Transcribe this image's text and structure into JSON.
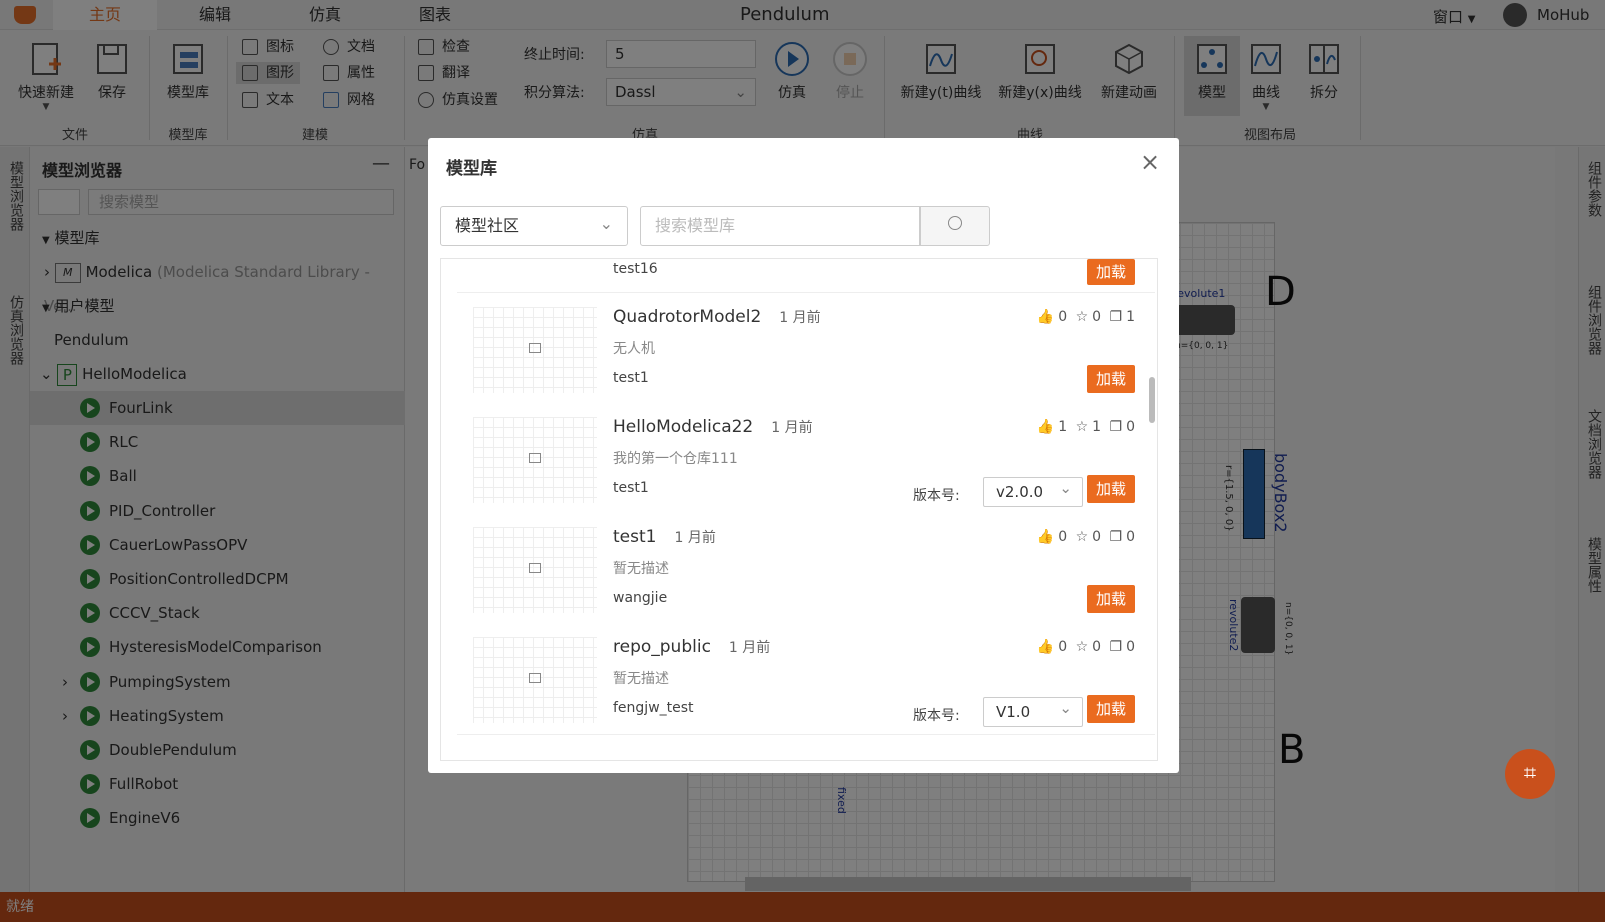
{
  "titlebar": {
    "title": "Pendulum",
    "window_menu": "窗口",
    "user": "MoHub",
    "tabs": [
      "主页",
      "编辑",
      "仿真",
      "图表"
    ]
  },
  "ribbon": {
    "quick_new": "快速新建",
    "save": "保存",
    "file_group": "文件",
    "library": "模型库",
    "library_group": "模型库",
    "icon": "图标",
    "graphic": "图形",
    "text": "文本",
    "doc": "文档",
    "attr": "属性",
    "grid": "网格",
    "modeling_group": "建模",
    "check": "检查",
    "translate": "翻译",
    "sim_settings": "仿真设置",
    "stop_time_label": "终止时间:",
    "stop_time_value": "5",
    "solver_label": "积分算法:",
    "solver_value": "Dassl",
    "simulate": "仿真",
    "stop": "停止",
    "sim_group": "仿真",
    "new_yt": "新建y(t)曲线",
    "new_yx": "新建y(x)曲线",
    "new_anim": "新建动画",
    "curve_group": "曲线",
    "view_model": "模型",
    "view_curve": "曲线",
    "view_split": "拆分",
    "layout_group": "视图布局"
  },
  "left_strip": {
    "model_browser": "模型浏览器",
    "sim_browser": "仿真浏览器"
  },
  "browser": {
    "title": "模型浏览器",
    "search_placeholder": "搜索模型",
    "library_section": "模型库",
    "modelica": "Modelica",
    "modelica_desc": "(Modelica Standard Library - Ve...",
    "user_section": "用户模型",
    "pendulum": "Pendulum",
    "hello": "HelloModelica",
    "children": [
      "FourLink",
      "RLC",
      "Ball",
      "PID_Controller",
      "CauerLowPassOPV",
      "PositionControlledDCPM",
      "CCCV_Stack",
      "HysteresisModelComparison",
      "PumpingSystem",
      "HeatingSystem",
      "DoublePendulum",
      "FullRobot",
      "EngineV6"
    ]
  },
  "right_strip": {
    "comp_params": "组件参数",
    "comp_browser": "组件浏览器",
    "doc_browser": "文档浏览器",
    "model_props": "模型属性"
  },
  "canvas": {
    "label_d": "D",
    "label_b": "B",
    "revolute1": "revolute1",
    "bodybox2": "bodyBox2",
    "revolute2": "revolute2",
    "fixed": "fixed",
    "n1": "n={0, 0, 1}",
    "r": "r={1.5, 0, 0}",
    "n2": "n={0, 0, 1}",
    "tab_prefix": "Fo"
  },
  "modal": {
    "title": "模型库",
    "category": "模型社区",
    "search_placeholder": "搜索模型库",
    "load_label": "加载",
    "version_label": "版本号:",
    "partial_owner": "test16",
    "cards": [
      {
        "name": "QuadrotorModel2",
        "time": "1 月前",
        "desc": "无人机",
        "owner": "test1",
        "likes": "0",
        "stars": "0",
        "copies": "1",
        "version": ""
      },
      {
        "name": "HelloModelica22",
        "time": "1 月前",
        "desc": "我的第一个仓库111",
        "owner": "test1",
        "likes": "1",
        "stars": "1",
        "copies": "0",
        "version": "v2.0.0"
      },
      {
        "name": "test1",
        "time": "1 月前",
        "desc": "暂无描述",
        "owner": "wangjie",
        "likes": "0",
        "stars": "0",
        "copies": "0",
        "version": ""
      },
      {
        "name": "repo_public",
        "time": "1 月前",
        "desc": "暂无描述",
        "owner": "fengjw_test",
        "likes": "0",
        "stars": "0",
        "copies": "0",
        "version": "V1.0"
      }
    ]
  },
  "status": {
    "text": "就绪"
  }
}
